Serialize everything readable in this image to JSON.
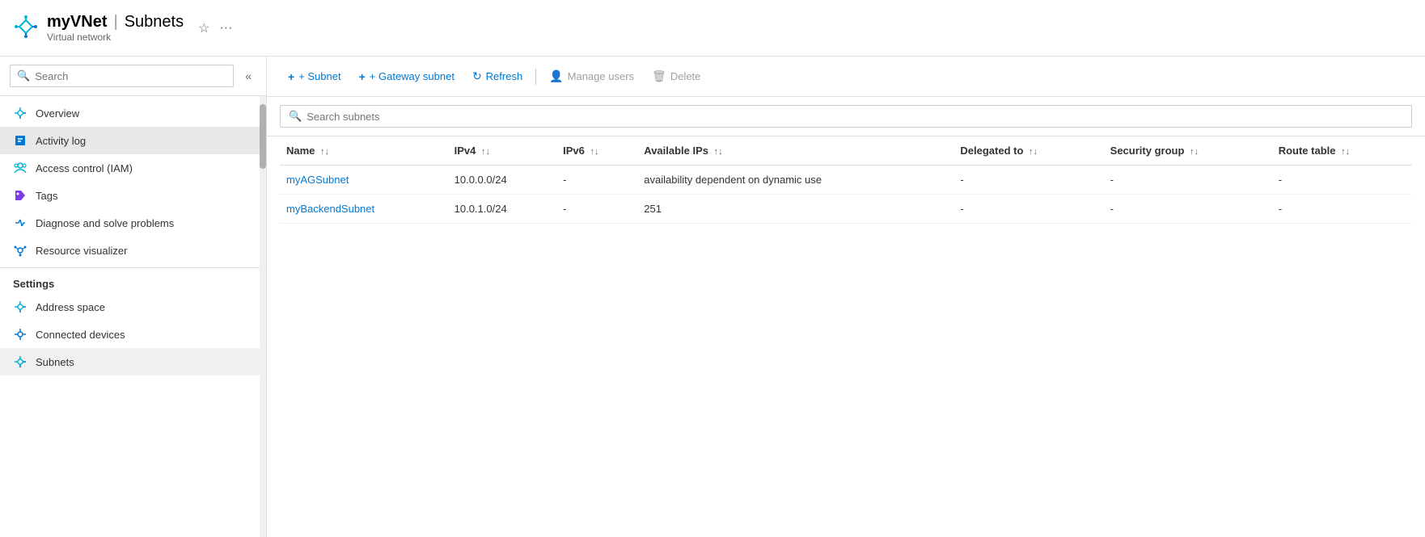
{
  "header": {
    "resource_name": "myVNet",
    "separator": "|",
    "page_name": "Subnets",
    "resource_type": "Virtual network",
    "star_label": "★",
    "more_label": "···"
  },
  "sidebar": {
    "search_placeholder": "Search",
    "collapse_icon": "«",
    "nav_items": [
      {
        "id": "overview",
        "label": "Overview",
        "icon": "vnet"
      },
      {
        "id": "activity-log",
        "label": "Activity log",
        "icon": "activity",
        "active": true
      },
      {
        "id": "access-control",
        "label": "Access control (IAM)",
        "icon": "iam"
      },
      {
        "id": "tags",
        "label": "Tags",
        "icon": "tag"
      },
      {
        "id": "diagnose",
        "label": "Diagnose and solve problems",
        "icon": "diagnose"
      },
      {
        "id": "resource-visualizer",
        "label": "Resource visualizer",
        "icon": "visualizer"
      }
    ],
    "settings_label": "Settings",
    "settings_items": [
      {
        "id": "address-space",
        "label": "Address space",
        "icon": "vnet"
      },
      {
        "id": "connected-devices",
        "label": "Connected devices",
        "icon": "devices"
      },
      {
        "id": "subnets",
        "label": "Subnets",
        "icon": "vnet"
      }
    ]
  },
  "toolbar": {
    "add_subnet_label": "+ Subnet",
    "add_gateway_label": "+ Gateway subnet",
    "refresh_label": "Refresh",
    "manage_users_label": "Manage users",
    "delete_label": "Delete"
  },
  "search": {
    "placeholder": "Search subnets"
  },
  "table": {
    "columns": [
      {
        "id": "name",
        "label": "Name",
        "sortable": true
      },
      {
        "id": "ipv4",
        "label": "IPv4",
        "sortable": true
      },
      {
        "id": "ipv6",
        "label": "IPv6",
        "sortable": true
      },
      {
        "id": "available-ips",
        "label": "Available IPs",
        "sortable": true
      },
      {
        "id": "delegated-to",
        "label": "Delegated to",
        "sortable": true
      },
      {
        "id": "security-group",
        "label": "Security group",
        "sortable": true
      },
      {
        "id": "route-table",
        "label": "Route table",
        "sortable": true
      }
    ],
    "rows": [
      {
        "name": "myAGSubnet",
        "name_link": true,
        "ipv4": "10.0.0.0/24",
        "ipv6": "-",
        "available_ips": "availability dependent on dynamic use",
        "delegated_to": "-",
        "security_group": "-",
        "route_table": "-"
      },
      {
        "name": "myBackendSubnet",
        "name_link": true,
        "ipv4": "10.0.1.0/24",
        "ipv6": "-",
        "available_ips": "251",
        "delegated_to": "-",
        "security_group": "-",
        "route_table": "-"
      }
    ]
  }
}
